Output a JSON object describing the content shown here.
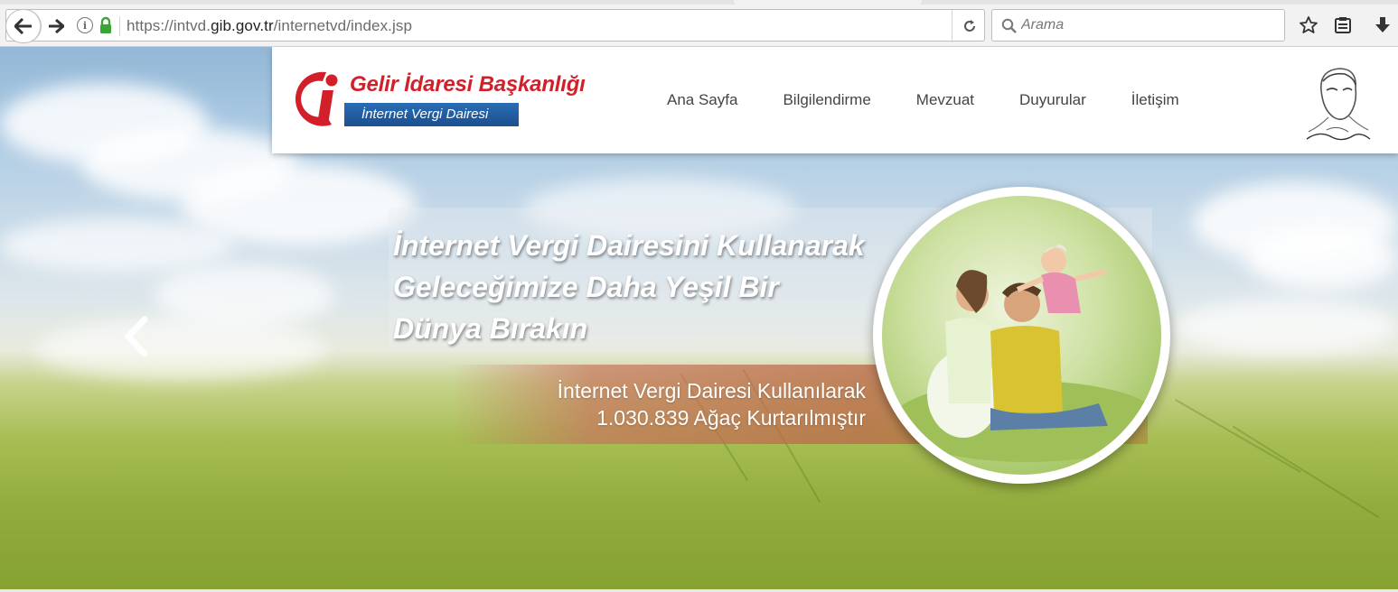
{
  "browser": {
    "url_prefix": "https://intvd.",
    "url_domain": "gib.gov.tr",
    "url_path": "/internetvd/index.jsp",
    "search_placeholder": "Arama"
  },
  "header": {
    "logo_title": "Gelir İdaresi Başkanlığı",
    "logo_subtitle": "İnternet Vergi Dairesi",
    "nav": [
      {
        "label": "Ana Sayfa"
      },
      {
        "label": "Bilgilendirme"
      },
      {
        "label": "Mevzuat"
      },
      {
        "label": "Duyurular"
      },
      {
        "label": "İletişim"
      }
    ]
  },
  "hero": {
    "headline_lines": [
      "İnternet Vergi Dairesini Kullanarak",
      "Geleceğimize Daha Yeşil Bir",
      "Dünya Bırakın"
    ],
    "counter_line1": "İnternet Vergi Dairesi Kullanılarak",
    "counter_line2": "1.030.839 Ağaç Kurtarılmıştır"
  },
  "colors": {
    "brand_red": "#d31f2a",
    "brand_blue": "#1b4f90",
    "lock_green": "#3aa535"
  }
}
